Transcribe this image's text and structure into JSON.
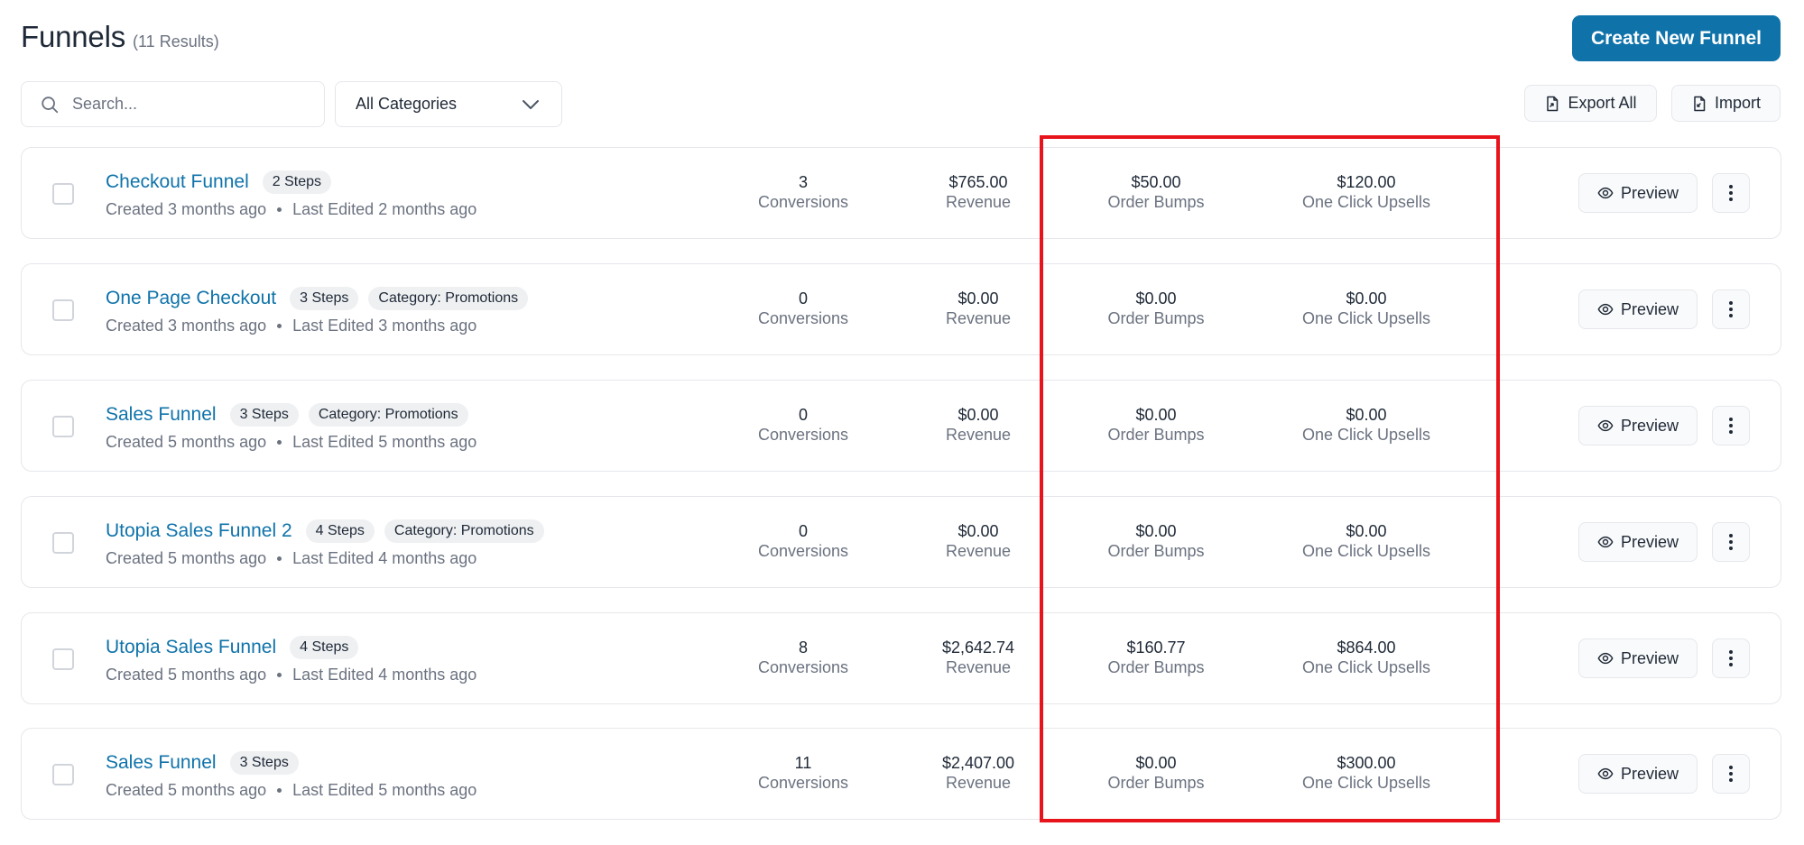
{
  "header": {
    "title": "Funnels",
    "result_count": "(11 Results)",
    "create_button": "Create New Funnel"
  },
  "toolbar": {
    "search_placeholder": "Search...",
    "category_selected": "All Categories",
    "export_label": "Export All",
    "import_label": "Import"
  },
  "stat_labels": {
    "conversions": "Conversions",
    "revenue": "Revenue",
    "order_bumps": "Order Bumps",
    "upsells": "One Click Upsells"
  },
  "row_actions": {
    "preview": "Preview"
  },
  "funnels": [
    {
      "name": "Checkout Funnel",
      "steps": "2 Steps",
      "category": "",
      "created": "Created 3 months ago",
      "edited": "Last Edited 2 months ago",
      "conversions": "3",
      "revenue": "$765.00",
      "order_bumps": "$50.00",
      "upsells": "$120.00"
    },
    {
      "name": "One Page Checkout",
      "steps": "3 Steps",
      "category": "Category: Promotions",
      "created": "Created 3 months ago",
      "edited": "Last Edited 3 months ago",
      "conversions": "0",
      "revenue": "$0.00",
      "order_bumps": "$0.00",
      "upsells": "$0.00"
    },
    {
      "name": "Sales Funnel",
      "steps": "3 Steps",
      "category": "Category: Promotions",
      "created": "Created 5 months ago",
      "edited": "Last Edited 5 months ago",
      "conversions": "0",
      "revenue": "$0.00",
      "order_bumps": "$0.00",
      "upsells": "$0.00"
    },
    {
      "name": "Utopia Sales Funnel 2",
      "steps": "4 Steps",
      "category": "Category: Promotions",
      "created": "Created 5 months ago",
      "edited": "Last Edited 4 months ago",
      "conversions": "0",
      "revenue": "$0.00",
      "order_bumps": "$0.00",
      "upsells": "$0.00"
    },
    {
      "name": "Utopia Sales Funnel",
      "steps": "4 Steps",
      "category": "",
      "created": "Created 5 months ago",
      "edited": "Last Edited 4 months ago",
      "conversions": "8",
      "revenue": "$2,642.74",
      "order_bumps": "$160.77",
      "upsells": "$864.00"
    },
    {
      "name": "Sales Funnel",
      "steps": "3 Steps",
      "category": "",
      "created": "Created 5 months ago",
      "edited": "Last Edited 5 months ago",
      "conversions": "11",
      "revenue": "$2,407.00",
      "order_bumps": "$0.00",
      "upsells": "$300.00"
    }
  ],
  "colors": {
    "primary": "#0f73aa",
    "highlight": "#e8141c",
    "muted_text": "#6b7280",
    "pill_bg": "#eef0f2",
    "border": "#e5e7eb"
  },
  "icons": {
    "search": "search-icon",
    "dropdown": "chevron-down-icon",
    "export": "export-file-icon",
    "import": "import-file-icon",
    "preview": "eye-icon",
    "more": "kebab-menu-icon"
  }
}
